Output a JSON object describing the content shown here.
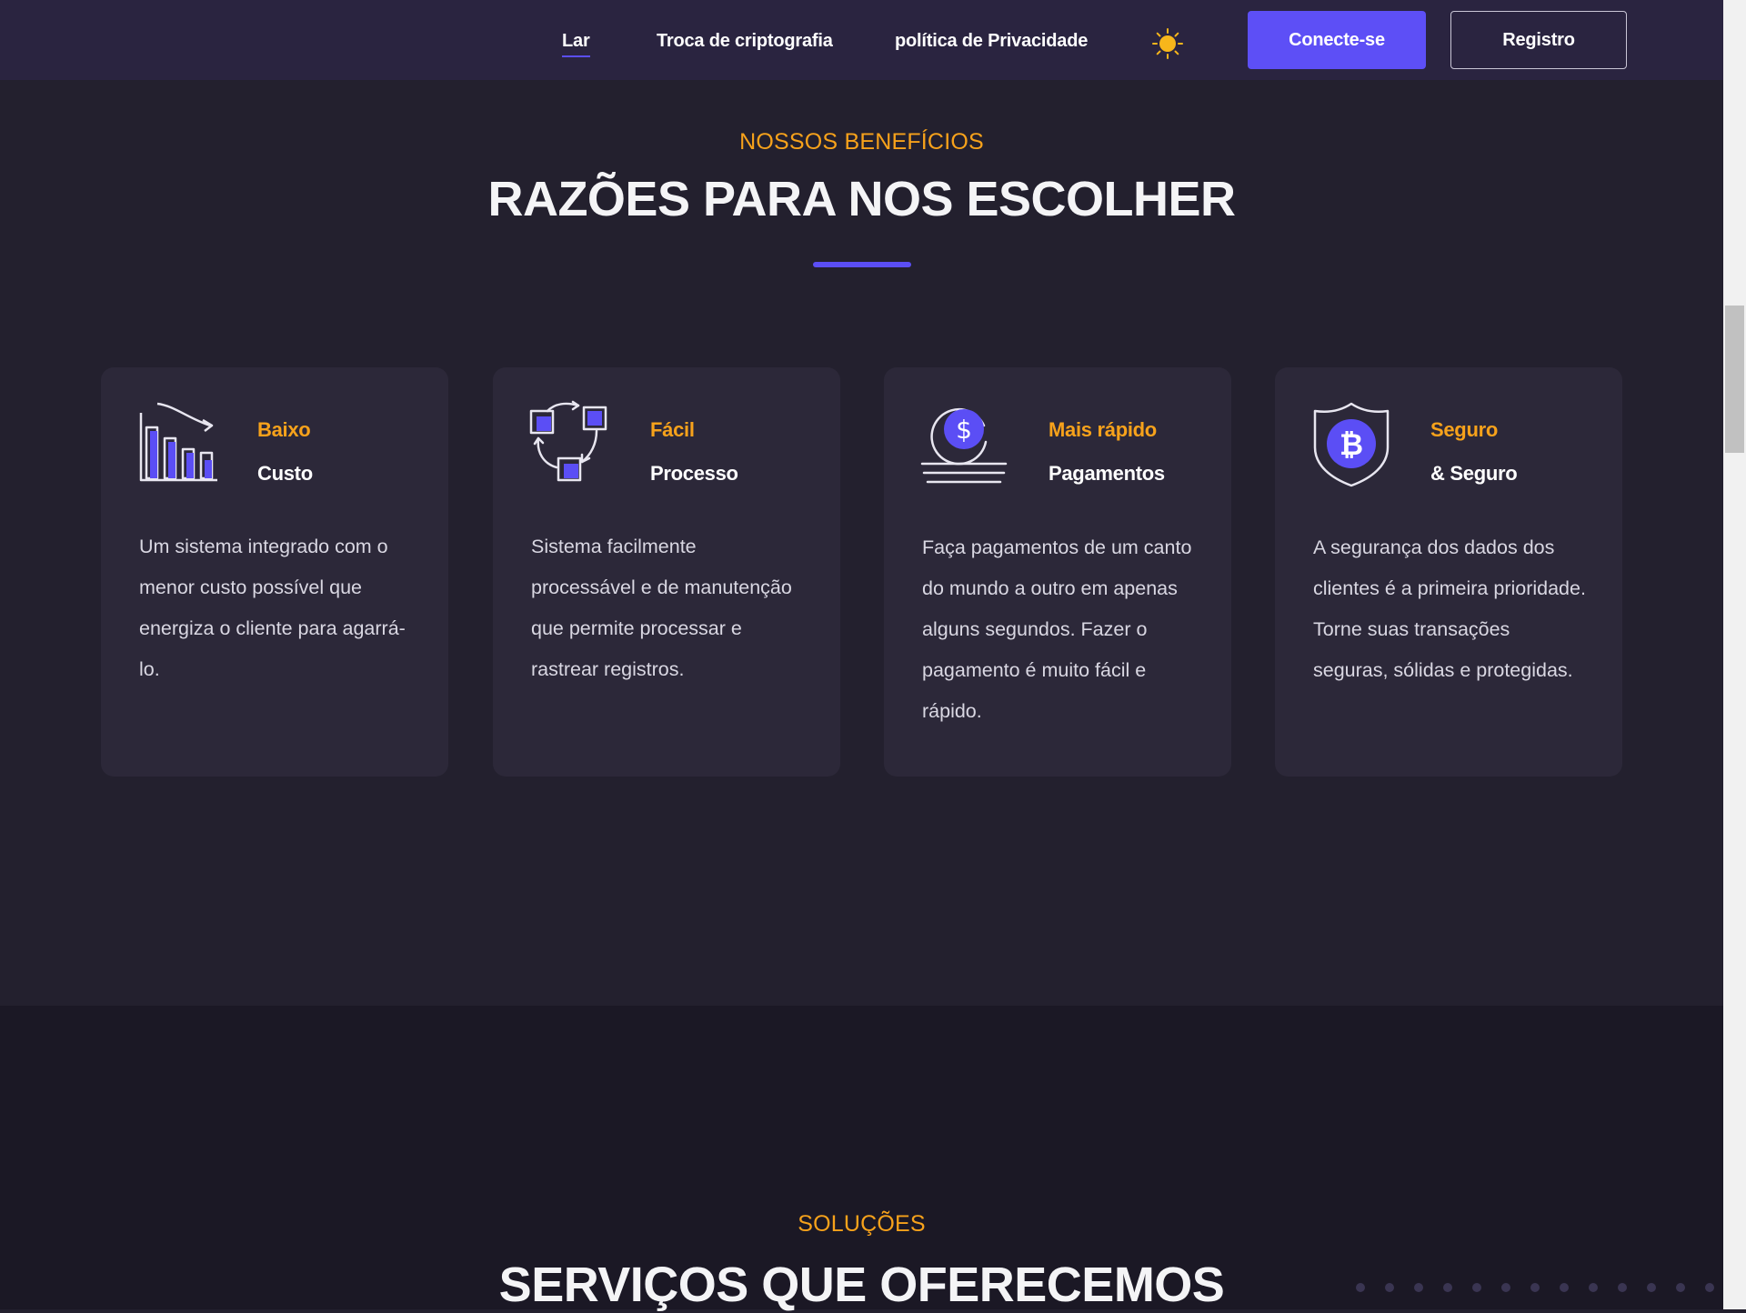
{
  "header": {
    "nav": [
      "Lar",
      "Troca de criptografia",
      "política de Privacidade"
    ],
    "login_label": "Conecte-se",
    "register_label": "Registro",
    "theme_icon": "sun-icon",
    "colors": {
      "background": "#2a2440",
      "accent": "#5d4ff6"
    }
  },
  "benefits": {
    "eyebrow": "NOSSOS BENEFÍCIOS",
    "title": "RAZÕES PARA NOS ESCOLHER",
    "cards": [
      {
        "icon": "chart-down-icon",
        "accent": "Baixo",
        "title": "Custo",
        "text": "Um sistema integrado com o menor custo possível que energiza o cliente para agarrá-lo."
      },
      {
        "icon": "process-cycle-icon",
        "accent": "Fácil",
        "title": "Processo",
        "text": "Sistema facilmente processável e de manutenção que permite processar e rastrear registros."
      },
      {
        "icon": "dollar-coin-icon",
        "accent": "Mais rápido",
        "title": "Pagamentos",
        "text": "Faça pagamentos de um canto do mundo a outro em apenas alguns segundos. Fazer o pagamento é muito fácil e rápido."
      },
      {
        "icon": "bitcoin-shield-icon",
        "accent": "Seguro",
        "title": "& Seguro",
        "text": "A segurança dos dados dos clientes é a primeira prioridade. Torne suas transações seguras, sólidas e protegidas."
      }
    ],
    "colors": {
      "accent_orange": "#f7a21b",
      "card_bg": "#2c2839",
      "purple": "#5b4ef5"
    }
  },
  "solutions": {
    "eyebrow": "SOLUÇÕES",
    "title": "SERVIÇOS QUE OFERECEMOS"
  }
}
